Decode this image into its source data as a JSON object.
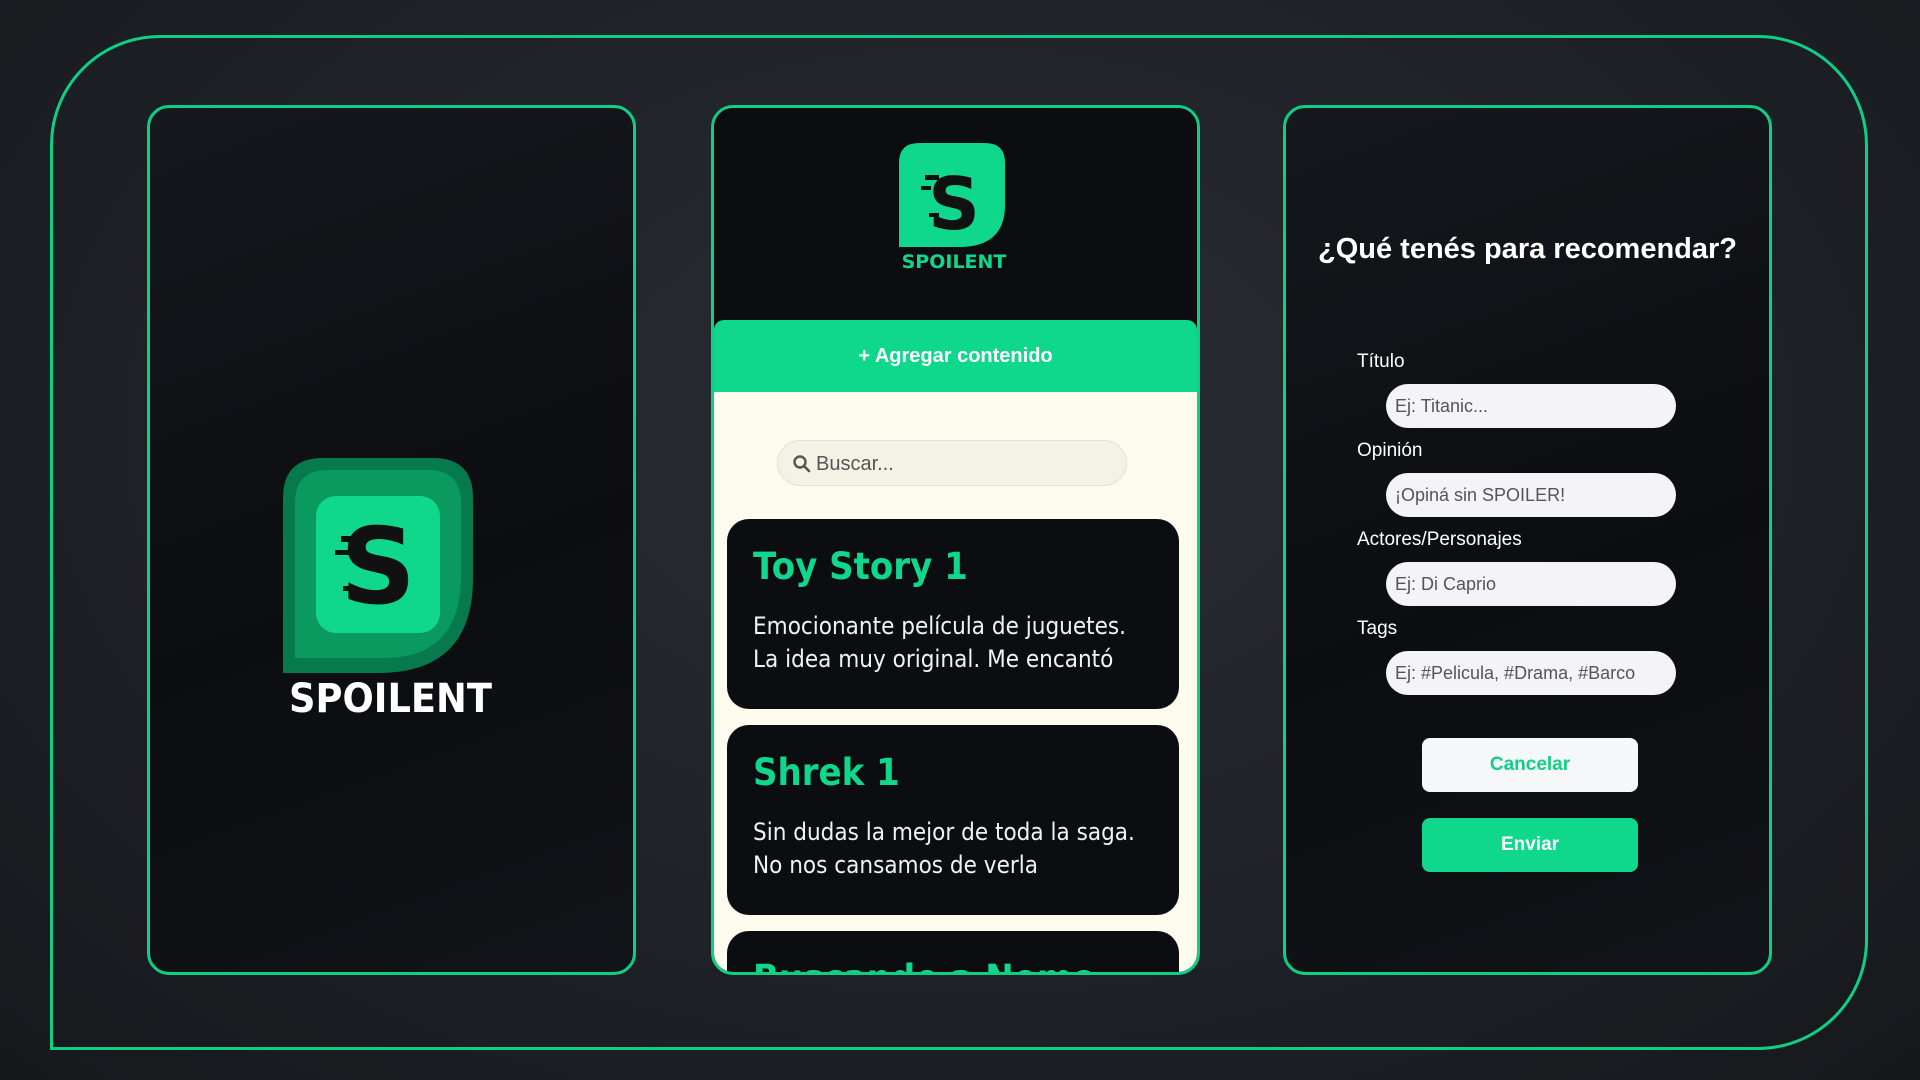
{
  "brand": {
    "name": "SPOILENT",
    "accent": "#0fd88d",
    "frame": "#0fcf85"
  },
  "feed": {
    "add_label": "+ Agregar contenido",
    "search": {
      "placeholder": "Buscar...",
      "icon": "search-icon"
    },
    "cards": [
      {
        "title": "Toy Story 1",
        "line1": "Emocionante película de juguetes.",
        "line2": "La idea muy original. Me encantó"
      },
      {
        "title": "Shrek 1",
        "line1": "Sin dudas la mejor de toda la saga.",
        "line2": "No nos cansamos de verla"
      },
      {
        "title": "Buscando a Nemo",
        "line1": "",
        "line2": ""
      }
    ]
  },
  "form": {
    "title": "¿Qué tenés para recomendar?",
    "fields": [
      {
        "label": "Título",
        "placeholder": "Ej: Titanic..."
      },
      {
        "label": "Opinión",
        "placeholder": "¡Opiná sin SPOILER!"
      },
      {
        "label": "Actores/Personajes",
        "placeholder": "Ej: Di Caprio"
      },
      {
        "label": "Tags",
        "placeholder": "Ej: #Pelicula, #Drama, #Barco"
      }
    ],
    "cancel_label": "Cancelar",
    "send_label": "Enviar"
  }
}
